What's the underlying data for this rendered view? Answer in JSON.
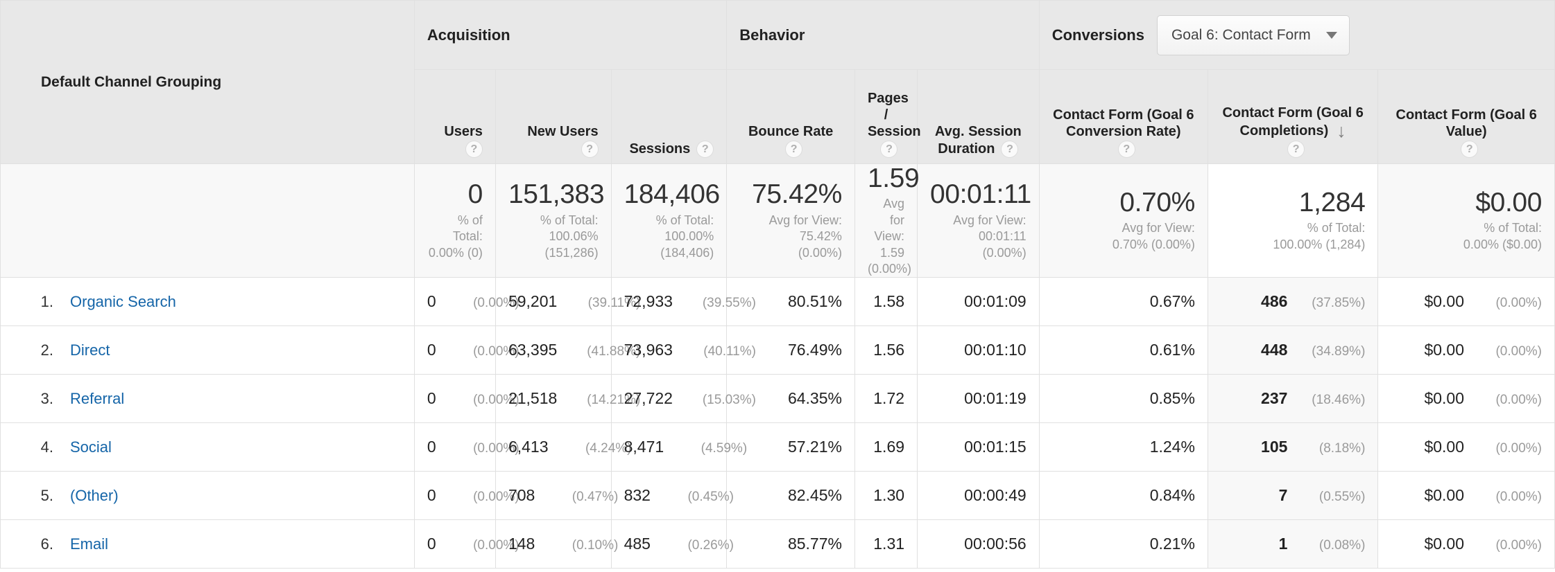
{
  "table": {
    "dimension_header": "Default Channel Grouping",
    "groups": [
      {
        "label": "Acquisition"
      },
      {
        "label": "Behavior"
      },
      {
        "label": "Conversions"
      }
    ],
    "conversions_goal_select": {
      "value": "Goal 6: Contact Form",
      "caret_icon": "chevron-down-icon"
    },
    "help_icon": "?",
    "sort_arrow_icon": "↓",
    "columns": [
      {
        "label": "Users",
        "help": true
      },
      {
        "label": "New Users",
        "help": true
      },
      {
        "label": "Sessions",
        "help": true
      },
      {
        "label": "Bounce Rate",
        "help": true
      },
      {
        "label": "Pages / Session",
        "help": true
      },
      {
        "label": "Avg. Session Duration",
        "help": true
      },
      {
        "label": "Contact Form (Goal 6 Conversion Rate)",
        "help": true
      },
      {
        "label": "Contact Form (Goal 6 Completions)",
        "help": true,
        "sorted": true,
        "sort_dir": "desc"
      },
      {
        "label": "Contact Form (Goal 6 Value)",
        "help": true
      }
    ],
    "summary": {
      "users": {
        "value": "0",
        "sub": "% of Total:\n0.00% (0)"
      },
      "new_users": {
        "value": "151,383",
        "sub": "% of Total:\n100.06%\n(151,286)"
      },
      "sessions": {
        "value": "184,406",
        "sub": "% of Total:\n100.00%\n(184,406)"
      },
      "bounce_rate": {
        "value": "75.42%",
        "sub": "Avg for View:\n75.42%\n(0.00%)"
      },
      "pages_session": {
        "value": "1.59",
        "sub": "Avg for\nView: 1.59\n(0.00%)"
      },
      "avg_duration": {
        "value": "00:01:11",
        "sub": "Avg for View:\n00:01:11\n(0.00%)"
      },
      "goal_rate": {
        "value": "0.70%",
        "sub": "Avg for View:\n0.70% (0.00%)"
      },
      "goal_compl": {
        "value": "1,284",
        "sub": "% of Total:\n100.00% (1,284)"
      },
      "goal_value": {
        "value": "$0.00",
        "sub": "% of Total:\n0.00% ($0.00)"
      }
    },
    "rows": [
      {
        "rank": "1.",
        "channel": "Organic Search",
        "users": "0",
        "users_pct": "(0.00%)",
        "new_users": "59,201",
        "new_users_pct": "(39.11%)",
        "sessions": "72,933",
        "sessions_pct": "(39.55%)",
        "bounce_rate": "80.51%",
        "pages_session": "1.58",
        "avg_duration": "00:01:09",
        "goal_rate": "0.67%",
        "goal_compl": "486",
        "goal_compl_pct": "(37.85%)",
        "goal_value": "$0.00",
        "goal_value_pct": "(0.00%)"
      },
      {
        "rank": "2.",
        "channel": "Direct",
        "users": "0",
        "users_pct": "(0.00%)",
        "new_users": "63,395",
        "new_users_pct": "(41.88%)",
        "sessions": "73,963",
        "sessions_pct": "(40.11%)",
        "bounce_rate": "76.49%",
        "pages_session": "1.56",
        "avg_duration": "00:01:10",
        "goal_rate": "0.61%",
        "goal_compl": "448",
        "goal_compl_pct": "(34.89%)",
        "goal_value": "$0.00",
        "goal_value_pct": "(0.00%)"
      },
      {
        "rank": "3.",
        "channel": "Referral",
        "users": "0",
        "users_pct": "(0.00%)",
        "new_users": "21,518",
        "new_users_pct": "(14.21%)",
        "sessions": "27,722",
        "sessions_pct": "(15.03%)",
        "bounce_rate": "64.35%",
        "pages_session": "1.72",
        "avg_duration": "00:01:19",
        "goal_rate": "0.85%",
        "goal_compl": "237",
        "goal_compl_pct": "(18.46%)",
        "goal_value": "$0.00",
        "goal_value_pct": "(0.00%)"
      },
      {
        "rank": "4.",
        "channel": "Social",
        "users": "0",
        "users_pct": "(0.00%)",
        "new_users": "6,413",
        "new_users_pct": "(4.24%)",
        "sessions": "8,471",
        "sessions_pct": "(4.59%)",
        "bounce_rate": "57.21%",
        "pages_session": "1.69",
        "avg_duration": "00:01:15",
        "goal_rate": "1.24%",
        "goal_compl": "105",
        "goal_compl_pct": "(8.18%)",
        "goal_value": "$0.00",
        "goal_value_pct": "(0.00%)"
      },
      {
        "rank": "5.",
        "channel": "(Other)",
        "users": "0",
        "users_pct": "(0.00%)",
        "new_users": "708",
        "new_users_pct": "(0.47%)",
        "sessions": "832",
        "sessions_pct": "(0.45%)",
        "bounce_rate": "82.45%",
        "pages_session": "1.30",
        "avg_duration": "00:00:49",
        "goal_rate": "0.84%",
        "goal_compl": "7",
        "goal_compl_pct": "(0.55%)",
        "goal_value": "$0.00",
        "goal_value_pct": "(0.00%)"
      },
      {
        "rank": "6.",
        "channel": "Email",
        "users": "0",
        "users_pct": "(0.00%)",
        "new_users": "148",
        "new_users_pct": "(0.10%)",
        "sessions": "485",
        "sessions_pct": "(0.26%)",
        "bounce_rate": "85.77%",
        "pages_session": "1.31",
        "avg_duration": "00:00:56",
        "goal_rate": "0.21%",
        "goal_compl": "1",
        "goal_compl_pct": "(0.08%)",
        "goal_value": "$0.00",
        "goal_value_pct": "(0.00%)"
      }
    ]
  },
  "colors": {
    "header_bg": "#e8e8e8",
    "summary_bg": "#f8f8f8",
    "link": "#1565a8",
    "muted": "#9a9a9a",
    "border": "#e0e0e0"
  }
}
